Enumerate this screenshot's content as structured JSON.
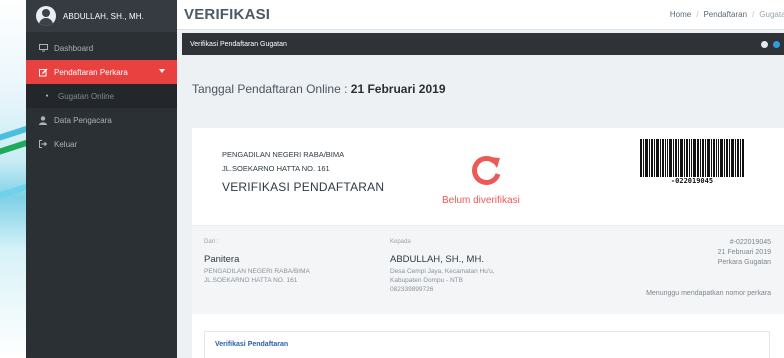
{
  "user": {
    "name": "ABDULLAH, SH., MH."
  },
  "sidebar": {
    "items": [
      {
        "label": "Dashboard",
        "icon": "monitor-icon"
      },
      {
        "label": "Pendaftaran Perkara",
        "icon": "edit-icon",
        "active": true
      },
      {
        "label": "Gugatan Online",
        "icon": "circle-icon",
        "sub": true
      },
      {
        "label": "Data Pengacara",
        "icon": "user-icon"
      },
      {
        "label": "Keluar",
        "icon": "sign-out-icon"
      }
    ]
  },
  "header": {
    "title": "VERIFIKASI",
    "breadcrumb": [
      "Home",
      "Pendaftaran",
      "Gugatan"
    ]
  },
  "panel": {
    "title": "Verifikasi Pendaftaran Gugatan"
  },
  "registration": {
    "date_label": "Tanggal Pendaftaran Online : ",
    "date_value": "21 Februari 2019"
  },
  "card": {
    "court_name": "PENGADILAN NEGERI RABA/BIMA",
    "court_address": "JL.SOEKARNO HATTA NO. 161",
    "heading": "VERIFIKASI PENDAFTARAN",
    "status": "Belum diverifikasi",
    "barcode_number": "-022019045"
  },
  "from": {
    "label": "Dari :",
    "name": "Panitera",
    "line1": "PENGADILAN NEGERI RABA/BIMA",
    "line2": "JL.SOEKARNO HATTA NO. 161"
  },
  "to": {
    "label": "Kepada",
    "name": "ABDULLAH, SH., MH.",
    "line1": "Desa Cempi Jaya, Kecamatan Hu'u,",
    "line2": "Kabupaten Dompu - NTB",
    "phone": "082339899726"
  },
  "meta": {
    "number": "#-022019045",
    "date": "21 Februari 2019",
    "type": "Perkara Gugatan",
    "note": "Menunggu mendapatkan nomor perkara"
  },
  "tabs": {
    "first": "Verifikasi Pendaftaran"
  },
  "colors": {
    "accent_red": "#e8413f",
    "status_red": "#ec5a55",
    "sidebar": "#2b3034",
    "link_blue": "#2b5fa8"
  }
}
